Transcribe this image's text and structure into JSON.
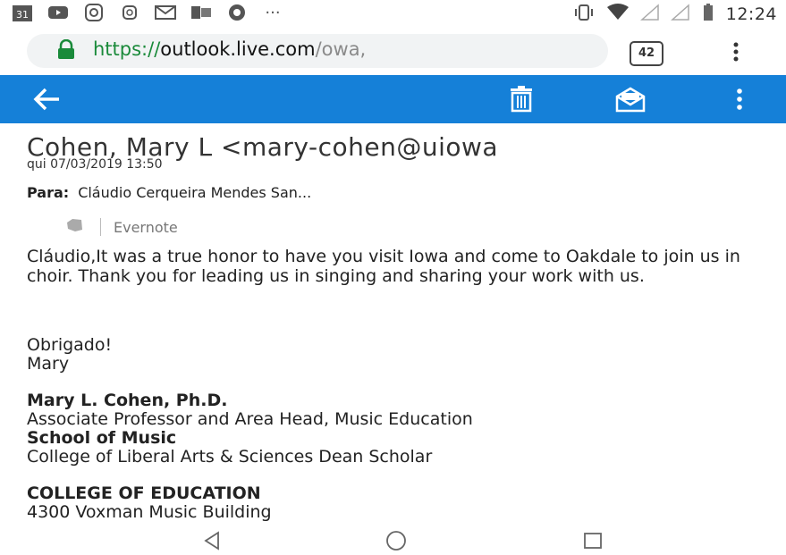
{
  "status_bar": {
    "time": "12:24",
    "icons": [
      "calendar-icon",
      "youtube-icon",
      "instagram-icon",
      "instagram-small-icon",
      "gmail-icon",
      "outlook-icon",
      "chrome-icon",
      "more-notifications-icon",
      "vibrate-icon",
      "wifi-icon",
      "signal-icon",
      "signal-icon",
      "battery-icon"
    ],
    "calendar_day": "31"
  },
  "browser": {
    "url_scheme": "https://",
    "url_host": "outlook.live.com",
    "url_path": "/owa,",
    "tab_count": "42"
  },
  "app_bar": {
    "accent": "#1580d8"
  },
  "email": {
    "from": "Cohen, Mary L <mary-cohen@uiowa",
    "date": "qui 07/03/2019 13:50",
    "to_label": "Para:",
    "to_value": "Cláudio Cerqueira Mendes San...",
    "addin": "Evernote",
    "body": {
      "greeting": "Cláudio,",
      "text": "It was a true honor to have you visit Iowa and come to Oakdale to join us in choir. Thank you for leading us in singing and sharing your work with us.",
      "closing": "Obrigado!",
      "closing_name": "Mary"
    },
    "signature": {
      "name": "Mary L. Cohen, Ph.D.",
      "title": "Associate Professor and Area Head, Music Education",
      "school": "School of Music",
      "college_line": "College of Liberal Arts & Sciences Dean Scholar",
      "org": "COLLEGE OF EDUCATION",
      "address": "4300 Voxman Music Building"
    }
  }
}
